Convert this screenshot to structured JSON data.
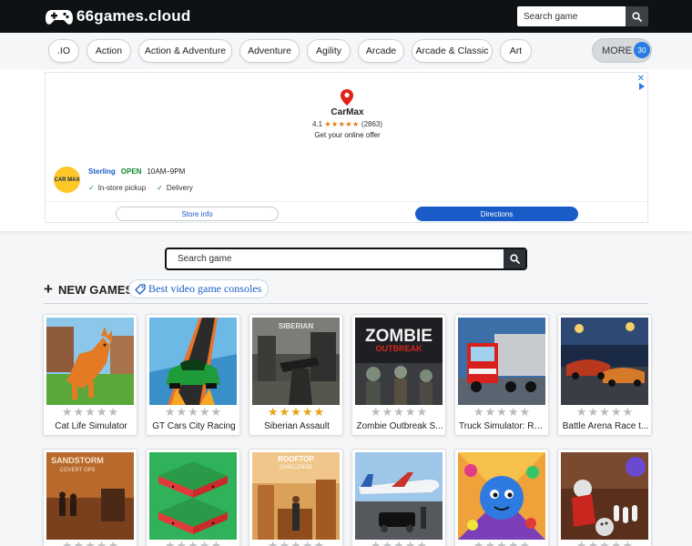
{
  "site": {
    "name": "66games.cloud"
  },
  "search": {
    "placeholder_top": "Search game",
    "placeholder_main": "Search game"
  },
  "categories": [
    ".IO",
    "Action",
    "Action & Adventure",
    "Adventure",
    "Agility",
    "Arcade",
    "Arcade & Classic",
    "Art"
  ],
  "more": {
    "label": "MORE",
    "count": "30"
  },
  "ad": {
    "brand": "CarMax",
    "rating_value": "4.1",
    "rating_stars": "★★★★★",
    "review_count": "(2863)",
    "offer": "Get your online offer",
    "logo_text": "CAR MAX",
    "city": "Sterling",
    "status": "OPEN",
    "hours": "10AM–9PM",
    "feature1": "In-store pickup",
    "feature2": "Delivery",
    "button_store": "Store info",
    "button_directions": "Directions",
    "close_glyph": "✕"
  },
  "section": {
    "title": "NEW GAMES",
    "link": "Best video game consoles"
  },
  "colors": {
    "accent": "#2a7be4",
    "star_on": "#e8a514",
    "star_off": "#b9bcbf",
    "header": "#0f1215"
  },
  "games": [
    {
      "title": "Cat Life Simulator",
      "stars": 0
    },
    {
      "title": "GT Cars City Racing",
      "stars": 0
    },
    {
      "title": "Siberian Assault",
      "stars": 5,
      "thumb_text": "SIBERIAN"
    },
    {
      "title": "Zombie Outbreak S...",
      "stars": 0,
      "thumb_text": "ZOMBIE",
      "thumb_text2": "OUTBREAK"
    },
    {
      "title": "Truck Simulator: Ru...",
      "stars": 0
    },
    {
      "title": "Battle Arena Race t...",
      "stars": 0
    },
    {
      "title": "",
      "stars": 0,
      "thumb_text": "SANDSTORM",
      "thumb_text2": "COVERT OPS"
    },
    {
      "title": "",
      "stars": 0
    },
    {
      "title": "",
      "stars": 0,
      "thumb_text": "ROOFTOP",
      "thumb_text2": "CHALLENGE"
    },
    {
      "title": "",
      "stars": 0
    },
    {
      "title": "",
      "stars": 0
    },
    {
      "title": "",
      "stars": 0
    }
  ]
}
